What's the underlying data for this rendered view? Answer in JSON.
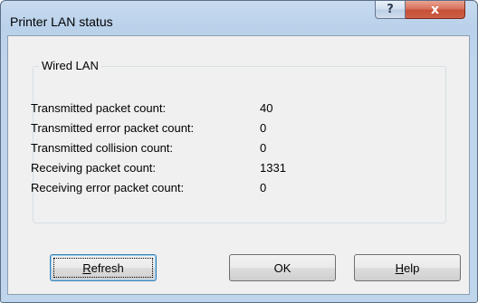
{
  "window": {
    "title": "Printer LAN status",
    "help_glyph": "?",
    "close_glyph": "x"
  },
  "group": {
    "title": "Wired LAN",
    "rows": [
      {
        "label": "Transmitted packet count:",
        "value": "40"
      },
      {
        "label": "Transmitted error packet count:",
        "value": "0"
      },
      {
        "label": "Transmitted collision count:",
        "value": "0"
      },
      {
        "label": "Receiving packet count:",
        "value": "1331"
      },
      {
        "label": "Receiving error packet count:",
        "value": "0"
      }
    ]
  },
  "buttons": {
    "refresh": {
      "mnemonic": "R",
      "rest": "efresh"
    },
    "ok": {
      "label": "OK"
    },
    "help": {
      "mnemonic": "H",
      "rest": "elp"
    }
  }
}
